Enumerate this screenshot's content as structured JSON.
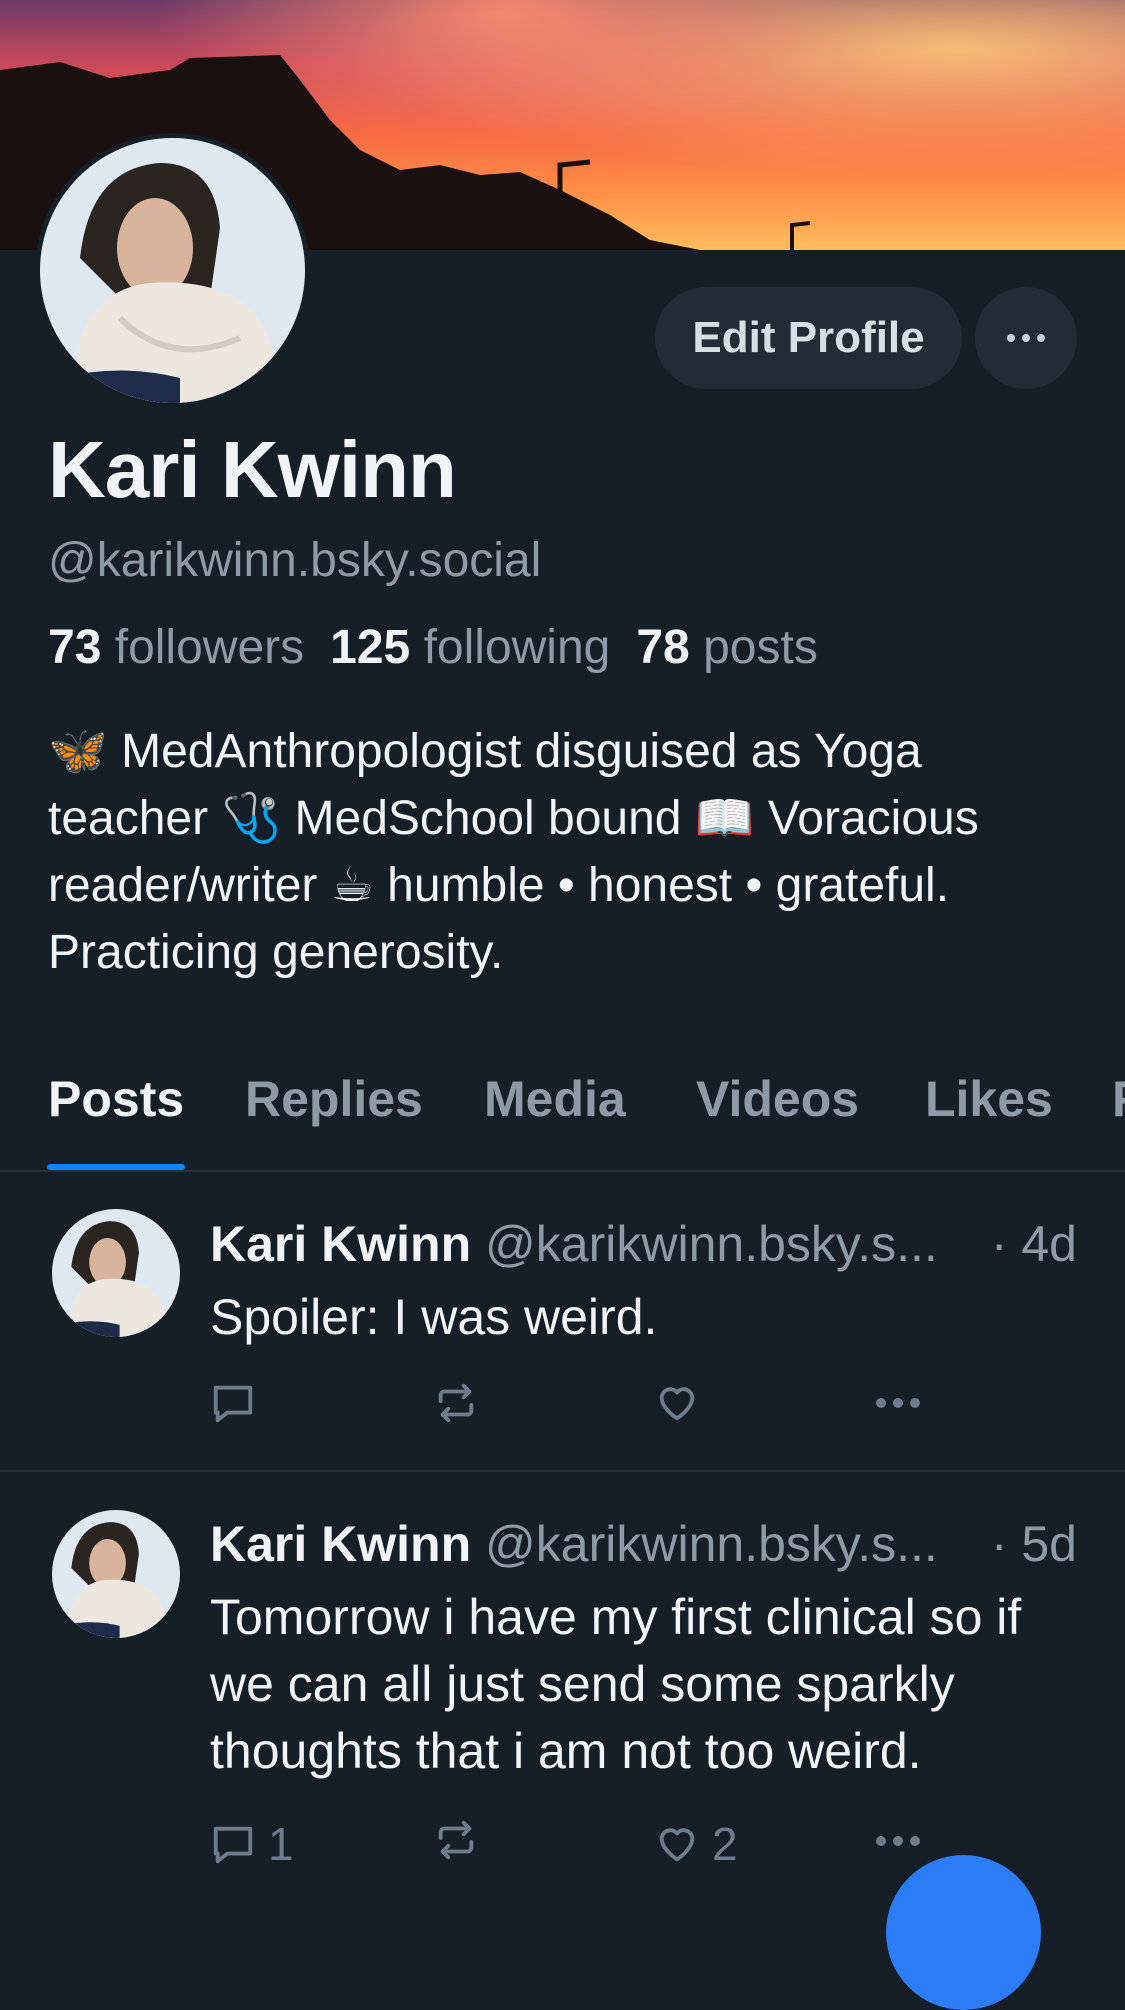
{
  "profile": {
    "display_name": "Kari Kwinn",
    "handle": "@karikwinn.bsky.social",
    "edit_label": "Edit Profile",
    "stats": {
      "followers_count": "73",
      "followers_label": "followers",
      "following_count": "125",
      "following_label": "following",
      "posts_count": "78",
      "posts_label": "posts"
    },
    "bio": "🦋 MedAnthropologist disguised as Yoga teacher 🩺 MedSchool bound 📖 Voracious reader/writer ☕ humble • honest • grateful. Practicing generosity."
  },
  "tabs": [
    "Posts",
    "Replies",
    "Media",
    "Videos",
    "Likes",
    "F"
  ],
  "posts": [
    {
      "name": "Kari Kwinn",
      "handle": "@karikwinn.bsky.s...",
      "time": "· 4d",
      "text": "Spoiler: I was weird.",
      "reply_count": "",
      "like_count": ""
    },
    {
      "name": "Kari Kwinn",
      "handle": "@karikwinn.bsky.s...",
      "time": "· 5d",
      "text": "Tomorrow i have my first clinical so if we can all just send some sparkly thoughts that i am not too weird.",
      "reply_count": "1",
      "like_count": "2"
    }
  ],
  "colors": {
    "background": "#161e27",
    "accent": "#1083fe",
    "muted_text": "#8d9aa8",
    "fab": "#2c7cf6"
  },
  "icons": [
    "more-icon",
    "reply-icon",
    "repost-icon",
    "like-icon",
    "post-more-icon"
  ]
}
